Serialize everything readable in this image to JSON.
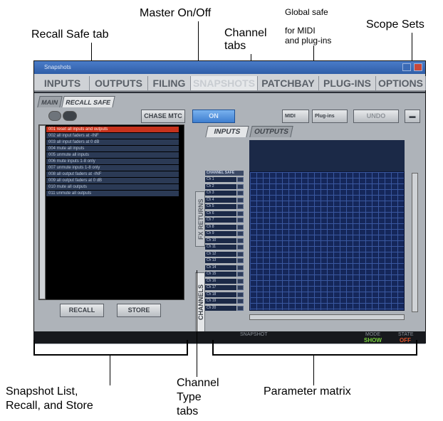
{
  "callouts": {
    "master": "Master On/Off",
    "recall_safe": "Recall Safe tab",
    "global_safe": "Global safe",
    "global_safe_2": "for MIDI",
    "global_safe_3": "and plug-ins",
    "scope_sets": "Scope Sets",
    "channel_tabs_1": "Channel",
    "channel_tabs_2": "tabs",
    "snapshot_list_1": "Snapshot List,",
    "snapshot_list_2": "Recall, and Store",
    "channel_type_1": "Channel",
    "channel_type_2": "Type",
    "channel_type_3": "tabs",
    "parameter_matrix": "Parameter matrix"
  },
  "window": {
    "title": "Snapshots",
    "tabs": [
      "INPUTS",
      "OUTPUTS",
      "FILING",
      "SNAPSHOTS",
      "PATCHBAY",
      "PLUG-INS",
      "OPTIONS"
    ],
    "subtabs": [
      "MAIN",
      "RECALL SAFE"
    ]
  },
  "controls": {
    "chase_mtc": "CHASE MTC",
    "master_on": "ON",
    "midi": "MIDI",
    "plugins": "Plug-ins",
    "undo": "UNDO",
    "recall": "RECALL",
    "store": "STORE"
  },
  "snapshots": [
    "001  reset all inputs and outputs",
    "002  all input faders at -INF",
    "003  all input faders at 0 dB",
    "004  mute all inputs",
    "005  unmute all inputs",
    "006  mute inputs 1-8 only",
    "007  unmute inputs 1-8 only",
    "008  all output faders at -INF",
    "009  all output faders at 0 dB",
    "010  mute all outputs",
    "011  unmute all outputs"
  ],
  "matrix": {
    "tabs": [
      "INPUTS",
      "OUTPUTS"
    ],
    "type_tabs": [
      "FX RETURNS",
      "CHANNELS"
    ],
    "header": "CHANNEL SAFE",
    "channels": [
      "Ch 1",
      "Ch 2",
      "Ch 3",
      "Ch 4",
      "Ch 5",
      "Ch 6",
      "Ch 7",
      "Ch 8",
      "Ch 9",
      "Ch 10",
      "Ch 11",
      "Ch 12",
      "Ch 13",
      "Ch 14",
      "Ch 15",
      "Ch 16",
      "Ch 17",
      "Ch 18",
      "Ch 19",
      "Ch 20"
    ]
  },
  "status_bar": {
    "snapshot_label": "SNAPSHOT",
    "mode_label": "MODE",
    "mode_value": "SHOW",
    "state_label": "STATE",
    "state_value": "OFF"
  },
  "colors": {
    "active_snapshot": "#c7321c",
    "matrix_bg": "#15275a",
    "master_on": "#4f8fd8",
    "show": "#78d23c",
    "off": "#e0522a"
  }
}
